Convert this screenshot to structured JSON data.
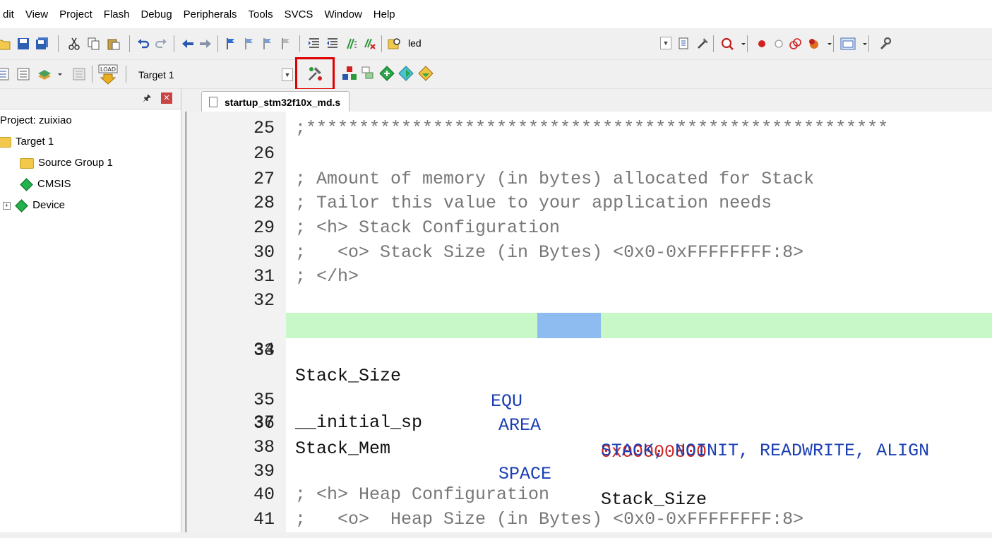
{
  "menu": [
    "dit",
    "View",
    "Project",
    "Flash",
    "Debug",
    "Peripherals",
    "Tools",
    "SVCS",
    "Window",
    "Help"
  ],
  "toolbar1": {
    "find_text": "led"
  },
  "toolbar2": {
    "load_label": "LOAD",
    "target_select": "Target 1"
  },
  "project": {
    "title": "Project: zuixiao",
    "target": "Target 1",
    "items": [
      "Source Group 1",
      "CMSIS",
      "Device"
    ]
  },
  "editor": {
    "tab": "startup_stm32f10x_md.s",
    "lines": [
      {
        "n": "25",
        "t": ";*******************************************************"
      },
      {
        "n": "26",
        "t": ""
      },
      {
        "n": "27",
        "t": "; Amount of memory (in bytes) allocated for Stack"
      },
      {
        "n": "28",
        "t": "; Tailor this value to your application needs"
      },
      {
        "n": "29",
        "t": "; <h> Stack Configuration"
      },
      {
        "n": "30",
        "t": ";   <o> Stack Size (in Bytes) <0x0-0xFFFFFFFF:8>"
      },
      {
        "n": "31",
        "t": "; </h>"
      },
      {
        "n": "32",
        "t": ""
      },
      {
        "n": "33",
        "label": "Stack_Size",
        "op": "EQU",
        "arg": "0x00000800"
      },
      {
        "n": "34",
        "t": ""
      },
      {
        "n": "35",
        "label": "",
        "op": "AREA",
        "arg": "STACK, NOINIT, READWRITE, ALIGN"
      },
      {
        "n": "36",
        "label": "Stack_Mem",
        "op": "SPACE",
        "arg": "Stack_Size"
      },
      {
        "n": "37",
        "t": "__initial_sp"
      },
      {
        "n": "38",
        "t": ""
      },
      {
        "n": "39",
        "t": ""
      },
      {
        "n": "40",
        "t": "; <h> Heap Configuration"
      },
      {
        "n": "41",
        "t": ";   <o>  Heap Size (in Bytes) <0x0-0xFFFFFFFF:8>"
      }
    ]
  },
  "colors": {
    "highlight_line": "#c8f7c8",
    "comment": "#777777",
    "keyword": "#1b3fb3",
    "number": "#cc2424",
    "callout_box": "#e00000"
  }
}
